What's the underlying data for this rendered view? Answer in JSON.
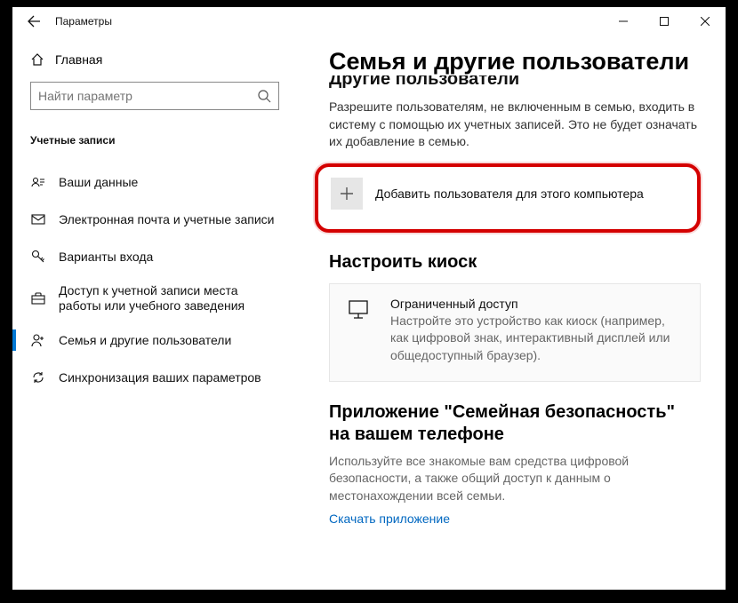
{
  "titlebar": {
    "title": "Параметры"
  },
  "sidebar": {
    "home": "Главная",
    "search_placeholder": "Найти параметр",
    "category": "Учетные записи",
    "items": [
      {
        "label": "Ваши данные"
      },
      {
        "label": "Электронная почта и учетные записи"
      },
      {
        "label": "Варианты входа"
      },
      {
        "label": "Доступ к учетной записи места работы или учебного заведения"
      },
      {
        "label": "Семья и другие пользователи"
      },
      {
        "label": "Синхронизация ваших параметров"
      }
    ]
  },
  "main": {
    "h1": "Семья и другие пользователи",
    "clipped_heading": "Другие пользователи",
    "intro": "Разрешите пользователям, не включенным в семью, входить в систему с помощью их учетных записей. Это не будет означать их добавление в семью.",
    "add_user": "Добавить пользователя для этого компьютера",
    "kiosk_heading": "Настроить киоск",
    "kiosk_title": "Ограниченный доступ",
    "kiosk_desc": "Настройте это устройство как киоск (например, как цифровой знак, интерактивный дисплей или общедоступный браузер).",
    "app_heading": "Приложение \"Семейная безопасность\" на вашем телефоне",
    "app_desc": "Используйте все знакомые вам средства цифровой безопасности, а также общий доступ к данным о местонахождении всей семьи.",
    "app_link": "Скачать приложение"
  }
}
